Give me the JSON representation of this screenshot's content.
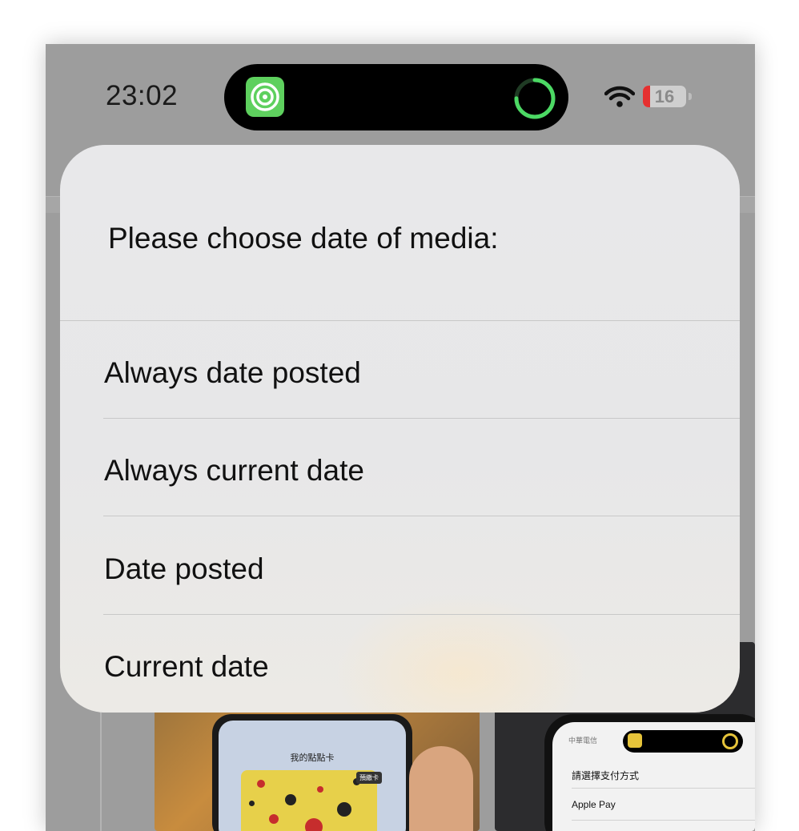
{
  "status_bar": {
    "time": "23:02",
    "battery_level": "16",
    "battery_fraction": 0.16
  },
  "dynamic_island": {
    "app_icon": "target-icon",
    "activity_indicator": "progress-ring-icon",
    "progress_fraction": 0.75
  },
  "action_sheet": {
    "title": "Please choose date of media:",
    "options": [
      {
        "label": "Always date posted"
      },
      {
        "label": "Always current date"
      },
      {
        "label": "Date posted"
      },
      {
        "label": "Current date"
      }
    ]
  },
  "background": {
    "left_thumbnail": {
      "card_title": "我的點點卡",
      "tag": "預繳卡"
    },
    "right_thumbnail": {
      "carrier": "中華電信",
      "rows": [
        "請選擇支付方式",
        "Apple Pay"
      ]
    }
  },
  "colors": {
    "app_icon_green": "#5ed05e",
    "ring_green": "#4cd964",
    "battery_red": "#e53030"
  }
}
